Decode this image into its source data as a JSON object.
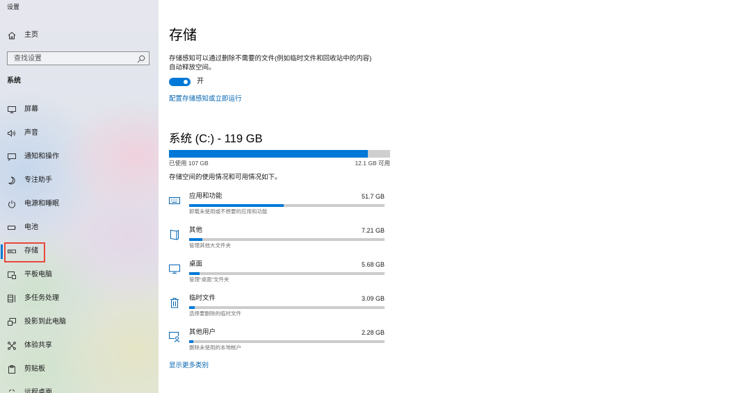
{
  "window": {
    "title": "设置"
  },
  "sidebar": {
    "home": {
      "label": "主页",
      "icon": "home-icon"
    },
    "search": {
      "placeholder": "查找设置",
      "icon": "search-icon"
    },
    "section_title": "系统",
    "items": [
      {
        "label": "屏幕",
        "icon": "monitor-icon"
      },
      {
        "label": "声音",
        "icon": "speaker-icon"
      },
      {
        "label": "通知和操作",
        "icon": "notification-icon"
      },
      {
        "label": "专注助手",
        "icon": "moon-icon"
      },
      {
        "label": "电源和睡眠",
        "icon": "power-icon"
      },
      {
        "label": "电池",
        "icon": "battery-icon"
      },
      {
        "label": "存储",
        "icon": "storage-icon",
        "selected": true
      },
      {
        "label": "平板电脑",
        "icon": "tablet-icon"
      },
      {
        "label": "多任务处理",
        "icon": "multitasking-icon"
      },
      {
        "label": "投影到此电脑",
        "icon": "projection-icon"
      },
      {
        "label": "体验共享",
        "icon": "shared-experiences-icon"
      },
      {
        "label": "剪贴板",
        "icon": "clipboard-icon"
      },
      {
        "label": "远程桌面",
        "icon": "remote-desktop-icon"
      }
    ]
  },
  "main": {
    "title": "存储",
    "description_lines": [
      "存储感知可以通过删除不需要的文件(例如临时文件和回收站中的内容)",
      "自动释放空间。"
    ],
    "storage_sense": {
      "on": true,
      "label": "开"
    },
    "configure_link": "配置存储感知或立即运行",
    "drive": {
      "title": "系统 (C:) - 119 GB",
      "used_label": "已使用 107 GB",
      "free_label": "12.1 GB 可用",
      "used_gb": 107,
      "free_gb": 12.1
    },
    "usage_note": "存储空间的使用情况和可用情况如下。",
    "categories": [
      {
        "name": "应用和功能",
        "size_label": "51.7 GB",
        "size_gb": 51.7,
        "description": "卸载未使用或不想要的应用和功能",
        "icon": "apps-icon"
      },
      {
        "name": "其他",
        "size_label": "7.21 GB",
        "size_gb": 7.21,
        "description": "管理其他大文件夹",
        "icon": "other-files-icon"
      },
      {
        "name": "桌面",
        "size_label": "5.68 GB",
        "size_gb": 5.68,
        "description": "管理“桌面”文件夹",
        "icon": "desktop-icon"
      },
      {
        "name": "临时文件",
        "size_label": "3.09 GB",
        "size_gb": 3.09,
        "description": "选择要删除的临时文件",
        "icon": "trash-icon"
      },
      {
        "name": "其他用户",
        "size_label": "2.28 GB",
        "size_gb": 2.28,
        "description": "删除未使用的本地帐户",
        "icon": "users-icon"
      }
    ],
    "show_more_link": "显示更多类别"
  },
  "colors": {
    "accent": "#0078d7",
    "link": "#0063b1",
    "track": "#cccccc",
    "highlight": "#e8473b",
    "category_icon": "#0063b1"
  }
}
